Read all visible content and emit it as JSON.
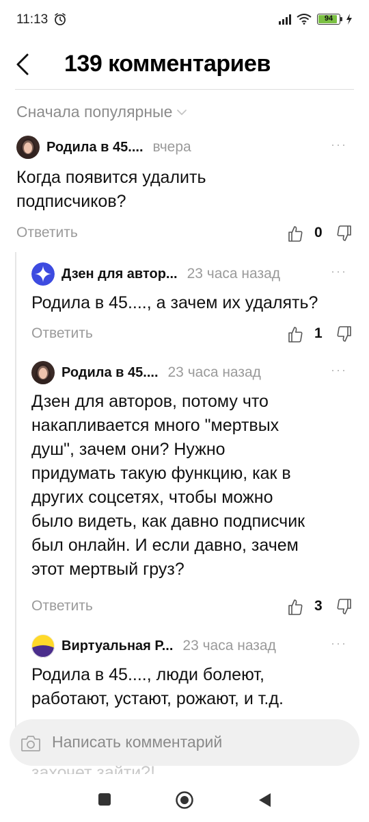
{
  "status_bar": {
    "time": "11:13",
    "battery": "94",
    "battery_level": 0.94,
    "icons": [
      "alarm-icon",
      "signal-icon",
      "wifi-icon",
      "battery-icon",
      "charging-icon"
    ]
  },
  "header": {
    "title": "139 комментариев",
    "back_icon": "chevron-left-icon"
  },
  "sort": {
    "label": "Сначала популярные",
    "icon": "chevron-down-icon"
  },
  "comments": [
    {
      "author": "Родила в 45....",
      "time": "вчера",
      "text_lines": [
        "Когда появится удалить",
        "подписчиков?"
      ],
      "reply_label": "Ответить",
      "likes": "0"
    },
    {
      "author": "Дзен для автор...",
      "time": "23 часа назад",
      "text_lines": [
        "Родила в 45...., а зачем их удалять?"
      ],
      "reply_label": "Ответить",
      "likes": "1"
    },
    {
      "author": "Родила в 45....",
      "time": "23 часа назад",
      "text_lines": [
        "Дзен для авторов, потому что",
        "накапливается много \"мертвых",
        "душ\", зачем они? Нужно",
        "придумать такую функцию, как в",
        "других соцсетях, чтобы можно",
        "было видеть, как давно подписчик",
        "был онлайн. И если давно, зачем",
        "этот мертвый груз?"
      ],
      "reply_label": "Ответить",
      "likes": "3"
    },
    {
      "author": "Виртуальная Р...",
      "time": "23 часа назад",
      "text_lines": [
        "Родила в 45...., люди болеют,",
        "работают, устают, рожают, и т.д."
      ]
    }
  ],
  "comment_input": {
    "placeholder": "Написать комментарий",
    "behind_text": "захочет зайти?!",
    "icon": "camera-icon"
  },
  "colors": {
    "muted_text": "#9a9a9a",
    "input_bg": "#f0f0f0",
    "battery_green": "#7bc043",
    "zen_blue": "#3d4be0",
    "virtual_yellow": "#ffd92a",
    "virtual_purple": "#4a2d8c"
  }
}
